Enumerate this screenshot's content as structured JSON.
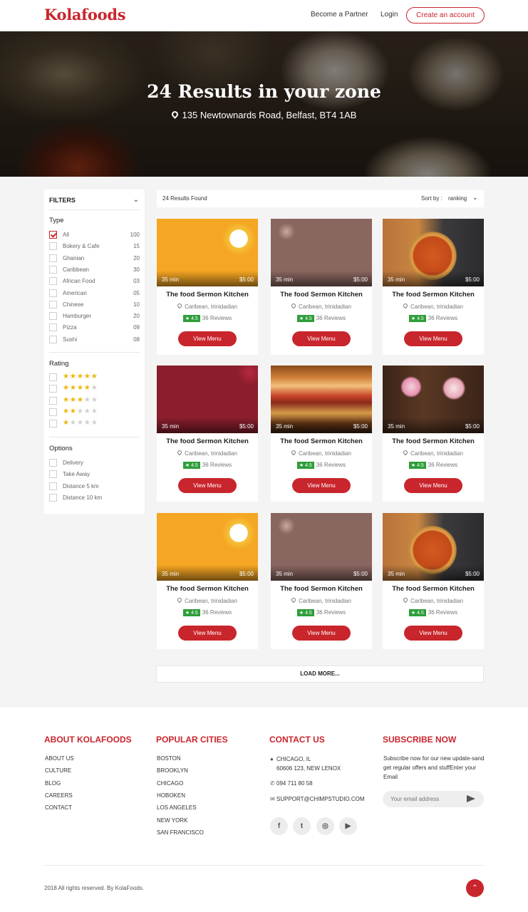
{
  "brand": {
    "name": "Kolafoods",
    "accent": "#c9252c"
  },
  "header": {
    "partner": "Become a Partner",
    "login": "Login",
    "create_account": "Create an account"
  },
  "hero": {
    "title": "24 Results in your zone",
    "address": "135 Newtownards Road, Belfast, BT4 1AB"
  },
  "filters": {
    "title": "FILTERS",
    "type_title": "Type",
    "types": [
      {
        "label": "All",
        "count": "100",
        "checked": true
      },
      {
        "label": "Bokery & Cafe",
        "count": "15"
      },
      {
        "label": "Ghanian",
        "count": "20"
      },
      {
        "label": "Caribbean",
        "count": "30"
      },
      {
        "label": "African Food",
        "count": "03"
      },
      {
        "label": "American",
        "count": "05"
      },
      {
        "label": "Chinese",
        "count": "10"
      },
      {
        "label": "Hamburger",
        "count": "20"
      },
      {
        "label": "Pizza",
        "count": "09"
      },
      {
        "label": "Sushi",
        "count": "08"
      }
    ],
    "rating_title": "Rating",
    "ratings": [
      5,
      4,
      3,
      2,
      1
    ],
    "options_title": "Options",
    "options": [
      "Delivery",
      "Take Away",
      "Distance 5 km",
      "Distance 10 km"
    ]
  },
  "sort": {
    "found": "24 Results Found",
    "label": "Sort by :",
    "value": "ranking"
  },
  "cards": [
    {
      "image": "eggs",
      "time": "35 min",
      "price": "$5:00",
      "name": "The food Sermon Kitchen",
      "location": "Caribean, trinidadian",
      "rating": "4.5",
      "reviews": "36 Reviews",
      "button": "View Menu"
    },
    {
      "image": "curry",
      "time": "35 min",
      "price": "$5:00",
      "name": "The food Sermon Kitchen",
      "location": "Caribean, trinidadian",
      "rating": "4.5",
      "reviews": "36 Reviews",
      "button": "View Menu"
    },
    {
      "image": "pizza",
      "time": "35 min",
      "price": "$5:00",
      "name": "The food Sermon Kitchen",
      "location": "Caribean, trinidadian",
      "rating": "4.5",
      "reviews": "36 Reviews",
      "button": "View Menu"
    },
    {
      "image": "wrap",
      "time": "35 min",
      "price": "$5:00",
      "name": "The food Sermon Kitchen",
      "location": "Caribean, trinidadian",
      "rating": "4.5",
      "reviews": "36 Reviews",
      "button": "View Menu"
    },
    {
      "image": "burger",
      "time": "35 min",
      "price": "$5:00",
      "name": "The food Sermon Kitchen",
      "location": "Caribean, trinidadian",
      "rating": "4.5",
      "reviews": "36 Reviews",
      "button": "View Menu"
    },
    {
      "image": "shake",
      "time": "35 min",
      "price": "$5:00",
      "name": "The food Sermon Kitchen",
      "location": "Caribean, trinidadian",
      "rating": "4.5",
      "reviews": "36 Reviews",
      "button": "View Menu"
    },
    {
      "image": "eggs",
      "time": "35 min",
      "price": "$5:00",
      "name": "The food Sermon Kitchen",
      "location": "Caribean, trinidadian",
      "rating": "4.5",
      "reviews": "36 Reviews",
      "button": "View Menu"
    },
    {
      "image": "curry",
      "time": "35 min",
      "price": "$5:00",
      "name": "The food Sermon Kitchen",
      "location": "Caribean, trinidadian",
      "rating": "4.5",
      "reviews": "36 Reviews",
      "button": "View Menu"
    },
    {
      "image": "pizza",
      "time": "35 min",
      "price": "$5:00",
      "name": "The food Sermon Kitchen",
      "location": "Caribean, trinidadian",
      "rating": "4.5",
      "reviews": "36 Reviews",
      "button": "View Menu"
    }
  ],
  "load_more": "LOAD MORE...",
  "footer": {
    "about_title": "ABOUT KOLAFOODS",
    "about_links": [
      "ABOUT US",
      "CULTURE",
      "BLOG",
      "CAREERS",
      "CONTACT"
    ],
    "cities_title": "POPULAR CITIES",
    "cities": [
      "BOSTON",
      "BROOKLYN",
      "CHICAGO",
      "HOBOKEN",
      "LOS ANGELES",
      "NEW YORK",
      "SAN FRANCISCO"
    ],
    "contact_title": "CONTACT US",
    "contact_address_1": "CHICAGO, IL",
    "contact_address_2": "60606 123, NEW LENOX",
    "contact_phone": "094 711 80 58",
    "contact_email": "SUPPORT@CHIMPSTUDIO.COM",
    "subscribe_title": "SUBSCRIBE NOW",
    "subscribe_text": "Subscribe now for our new update-sand get regular offers and stuffEnter your Email",
    "email_placeholder": "Your email address",
    "social": [
      {
        "icon": "facebook-icon",
        "glyph": "f"
      },
      {
        "icon": "twitter-icon",
        "glyph": "t"
      },
      {
        "icon": "instagram-icon",
        "glyph": "◎"
      },
      {
        "icon": "youtube-icon",
        "glyph": "▶"
      }
    ],
    "copyright": "2018 All rights reserved. By KolaFoods."
  }
}
